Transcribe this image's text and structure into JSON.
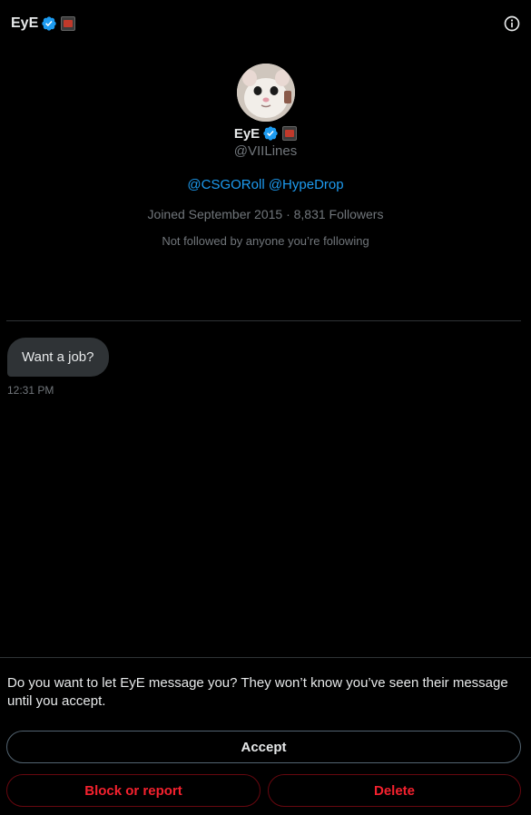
{
  "header": {
    "title": "EyE"
  },
  "profile": {
    "name": "EyE",
    "handle": "@VIILines",
    "bio_links": [
      "@CSGORoll",
      "@HypeDrop"
    ],
    "meta": "Joined September 2015 · 8,831 Followers",
    "followed_note": "Not followed by anyone you’re following"
  },
  "messages": [
    {
      "text": "Want a job?",
      "time": "12:31 PM"
    }
  ],
  "request": {
    "prompt": "Do you want to let EyE message you? They won’t know you’ve seen their message until you accept.",
    "accept_label": "Accept",
    "block_label": "Block or report",
    "delete_label": "Delete"
  },
  "colors": {
    "background": "#000000",
    "accent": "#1d9bf0",
    "danger": "#f4212e",
    "muted": "#71767b"
  },
  "icons": [
    "verified-badge-icon",
    "affiliate-badge-icon",
    "info-icon"
  ]
}
